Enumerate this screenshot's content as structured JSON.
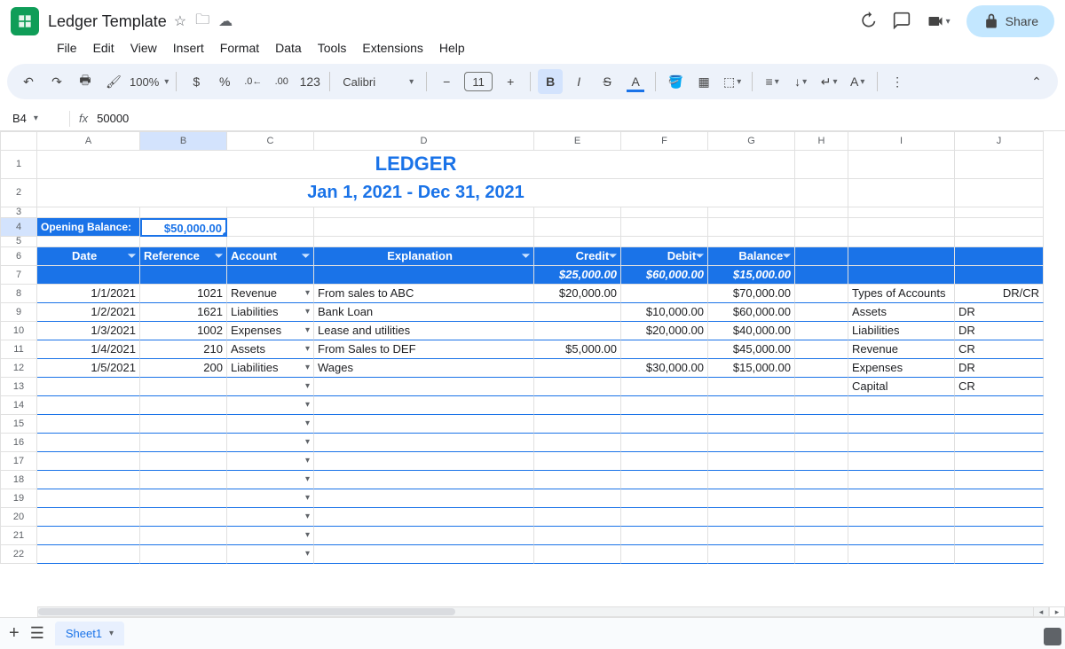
{
  "doc": {
    "title": "Ledger Template"
  },
  "menus": [
    "File",
    "Edit",
    "View",
    "Insert",
    "Format",
    "Data",
    "Tools",
    "Extensions",
    "Help"
  ],
  "toolbar": {
    "zoom": "100%",
    "font": "Calibri",
    "size": "11"
  },
  "share": "Share",
  "formula": {
    "cellRef": "B4",
    "value": "50000"
  },
  "columns": [
    "A",
    "B",
    "C",
    "D",
    "E",
    "F",
    "G",
    "H",
    "I",
    "J"
  ],
  "ledger": {
    "title": "LEDGER",
    "subtitle": "Jan 1, 2021 - Dec 31, 2021",
    "openingLabel": "Opening Balance:",
    "openingValue": "$50,000.00",
    "headers": [
      "Date",
      "Reference",
      "Account",
      "Explanation",
      "Credit",
      "Debit",
      "Balance"
    ],
    "totals": {
      "credit": "$25,000.00",
      "debit": "$60,000.00",
      "balance": "$15,000.00"
    },
    "rows": [
      {
        "date": "1/1/2021",
        "ref": "1021",
        "acct": "Revenue",
        "expl": "From sales to ABC",
        "credit": "$20,000.00",
        "debit": "",
        "bal": "$70,000.00"
      },
      {
        "date": "1/2/2021",
        "ref": "1621",
        "acct": "Liabilities",
        "expl": "Bank Loan",
        "credit": "",
        "debit": "$10,000.00",
        "bal": "$60,000.00"
      },
      {
        "date": "1/3/2021",
        "ref": "1002",
        "acct": "Expenses",
        "expl": "Lease and utilities",
        "credit": "",
        "debit": "$20,000.00",
        "bal": "$40,000.00"
      },
      {
        "date": "1/4/2021",
        "ref": "210",
        "acct": "Assets",
        "expl": "From Sales to DEF",
        "credit": "$5,000.00",
        "debit": "",
        "bal": "$45,000.00"
      },
      {
        "date": "1/5/2021",
        "ref": "200",
        "acct": "Liabilities",
        "expl": "Wages",
        "credit": "",
        "debit": "$30,000.00",
        "bal": "$15,000.00"
      }
    ]
  },
  "accounts": {
    "h1": "Types of Accounts",
    "h2": "DR/CR",
    "rows": [
      {
        "t": "Assets",
        "v": "DR"
      },
      {
        "t": "Liabilities",
        "v": "DR"
      },
      {
        "t": "Revenue",
        "v": "CR"
      },
      {
        "t": "Expenses",
        "v": "DR"
      },
      {
        "t": "Capital",
        "v": "CR"
      }
    ]
  },
  "sheet": "Sheet1"
}
